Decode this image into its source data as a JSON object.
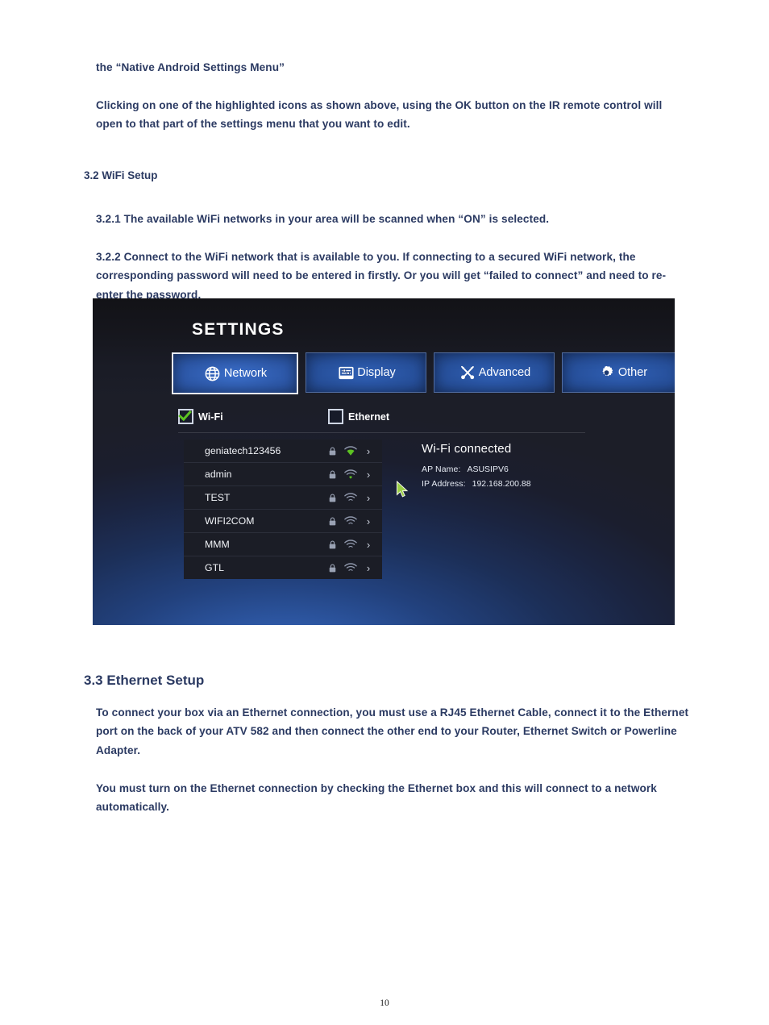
{
  "document": {
    "paragraphs": {
      "intro_1": "the “Native Android Settings Menu”",
      "intro_2": "Clicking on one of the highlighted icons as shown above, using the OK button on the IR remote control will open to that part of the settings menu that you want to edit.",
      "s321": "3.2.1 The available WiFi networks in your area will be scanned when “ON” is selected.",
      "s322": "3.2.2 Connect to the WiFi network that is available to you. If connecting to a secured WiFi network, the corresponding password will need to be entered in firstly. Or you will get “failed to connect” and need to re-enter the password.",
      "s331": "To connect your box via an Ethernet connection, you must use a RJ45 Ethernet Cable, connect it to the Ethernet port on the back of your ATV 582 and then connect the other end to your Router, Ethernet Switch or Powerline Adapter.",
      "s332": "You must turn on the Ethernet connection by checking the Ethernet box and this will connect to a network automatically."
    },
    "headings": {
      "s32": "3.2 WiFi Setup",
      "s33": "3.3 Ethernet Setup"
    },
    "page_number": "10",
    "text_color": "#2b3a62"
  },
  "screenshot": {
    "title": "SETTINGS",
    "nav_buttons": [
      {
        "label": "Network",
        "icon": "globe-icon",
        "selected": true
      },
      {
        "label": "Display",
        "icon": "sliders-icon",
        "selected": false
      },
      {
        "label": "Advanced",
        "icon": "tools-icon",
        "selected": false
      },
      {
        "label": "Other",
        "icon": "gear-icon",
        "selected": false
      }
    ],
    "toggles": [
      {
        "label": "Wi-Fi",
        "checked": true
      },
      {
        "label": "Ethernet",
        "checked": false
      }
    ],
    "wifi_networks": [
      {
        "ssid": "geniatech123456",
        "secured": true,
        "signal": 4
      },
      {
        "ssid": "admin",
        "secured": true,
        "signal": 1
      },
      {
        "ssid": "TEST",
        "secured": true,
        "signal": 0
      },
      {
        "ssid": "WIFI2COM",
        "secured": true,
        "signal": 0
      },
      {
        "ssid": "MMM",
        "secured": true,
        "signal": 0
      },
      {
        "ssid": "GTL",
        "secured": true,
        "signal": 0
      }
    ],
    "connection": {
      "status": "Wi-Fi connected",
      "ap_name_label": "AP Name:",
      "ap_name_value": "ASUSIPV6",
      "ip_label": "IP Address:",
      "ip_value": "192.168.200.88"
    },
    "colors": {
      "accent_blue": "#2d58a8",
      "check_green": "#5cc222",
      "panel_dark": "#1b1d26"
    }
  }
}
